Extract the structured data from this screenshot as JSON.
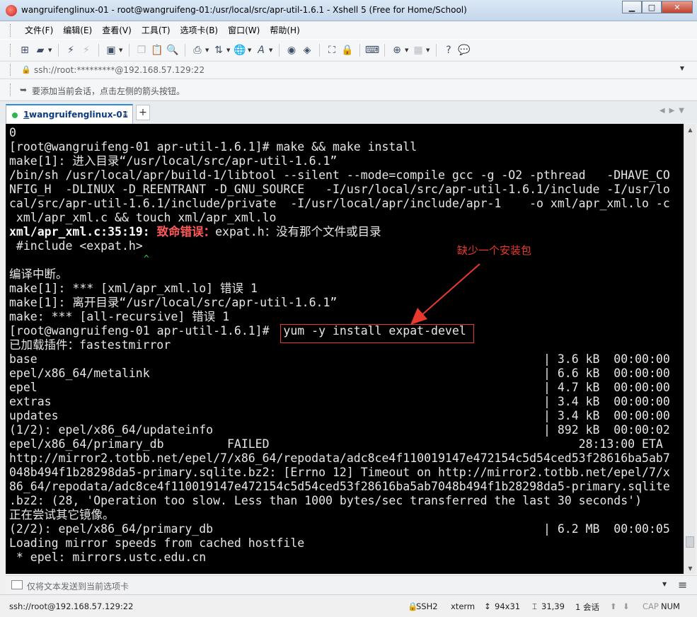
{
  "window": {
    "title": "wangruifenglinux-01 - root@wangruifeng-01:/usr/local/src/apr-util-1.6.1 - Xshell 5 (Free for Home/School)"
  },
  "menu": [
    "文件(F)",
    "编辑(E)",
    "查看(V)",
    "工具(T)",
    "选项卡(B)",
    "窗口(W)",
    "帮助(H)"
  ],
  "address": {
    "value": "ssh://root:*********@192.168.57.129:22"
  },
  "hint": {
    "text": "要添加当前会话，点击左侧的箭头按钮。"
  },
  "tab": {
    "number": "1",
    "label": " wangruifenglinux-01",
    "add": "+"
  },
  "terminal": {
    "lines": [
      "0",
      "[root@wangruifeng-01 apr-util-1.6.1]# make && make install",
      "make[1]: 进入目录“/usr/local/src/apr-util-1.6.1”",
      "/bin/sh /usr/local/apr/build-1/libtool --silent --mode=compile gcc -g -O2 -pthread   -DHAVE_CO",
      "NFIG_H  -DLINUX -D_REENTRANT -D_GNU_SOURCE   -I/usr/local/src/apr-util-1.6.1/include -I/usr/lo",
      "cal/src/apr-util-1.6.1/include/private  -I/usr/local/apr/include/apr-1    -o xml/apr_xml.lo -c",
      " xml/apr_xml.c && touch xml/apr_xml.lo",
      "",
      " #include <expat.h>",
      "",
      "编译中断。",
      "make[1]: *** [xml/apr_xml.lo] 错误 1",
      "make[1]: 离开目录“/usr/local/src/apr-util-1.6.1”",
      "make: *** [all-recursive] 错误 1",
      "[root@wangruifeng-01 apr-util-1.6.1]#  yum -y install expat-devel",
      "已加载插件：fastestmirror",
      "base                                                                        | 3.6 kB  00:00:00",
      "epel/x86_64/metalink                                                        | 6.6 kB  00:00:00",
      "epel                                                                        | 4.7 kB  00:00:00",
      "extras                                                                      | 3.4 kB  00:00:00",
      "updates                                                                     | 3.4 kB  00:00:00",
      "(1/2): epel/x86_64/updateinfo                                               | 892 kB  00:00:02",
      "epel/x86_64/primary_db         FAILED                                            28:13:00 ETA",
      "http://mirror2.totbb.net/epel/7/x86_64/repodata/adc8ce4f110019147e472154c5d54ced53f28616ba5ab7",
      "048b494f1b28298da5-primary.sqlite.bz2: [Errno 12] Timeout on http://mirror2.totbb.net/epel/7/x",
      "86_64/repodata/adc8ce4f110019147e472154c5d54ced53f28616ba5ab7048b494f1b28298da5-primary.sqlite",
      ".bz2: (28, 'Operation too slow. Less than 1000 bytes/sec transferred the last 30 seconds')",
      "正在尝试其它镜像。",
      "(2/2): epel/x86_64/primary_db                                               | 6.2 MB  00:00:05",
      "Loading mirror speeds from cached hostfile",
      " * epel: mirrors.ustc.edu.cn"
    ],
    "error_line": {
      "file": "xml/apr_xml.c:35:19:",
      "label": " 致命错误：",
      "message": "expat.h：没有那个文件或目录"
    },
    "caret": "^"
  },
  "annotation": {
    "text": "缺少一个安装包",
    "color": "#e8392e"
  },
  "send_bar": {
    "placeholder": "仅将文本发送到当前选项卡"
  },
  "status": {
    "connection": "ssh://root@192.168.57.129:22",
    "protocol": "SSH2",
    "terminal_type": "xterm",
    "size": "94x31",
    "cursor": "31,39",
    "sessions": "1 会话",
    "caps": "CAP",
    "num": "NUM"
  }
}
